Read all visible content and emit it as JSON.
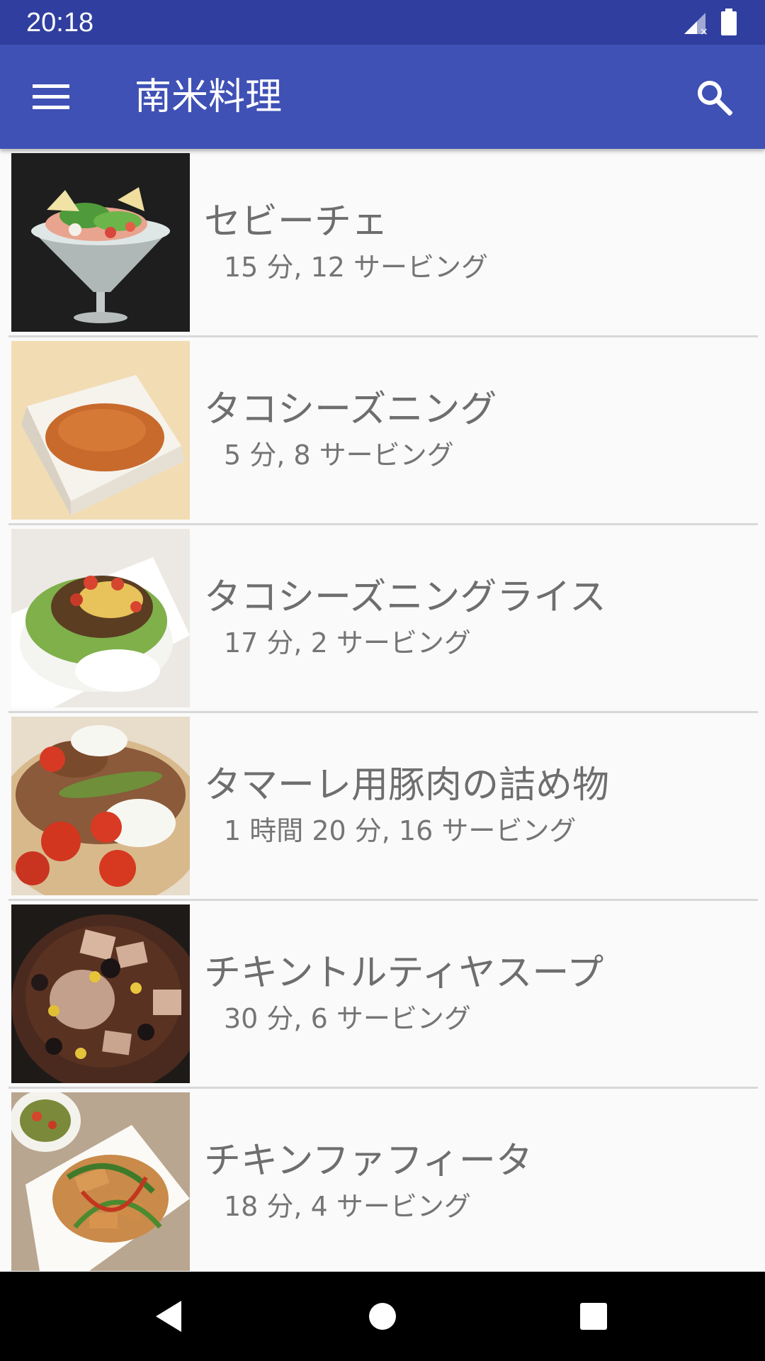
{
  "status_bar": {
    "time": "20:18",
    "icons": [
      "signal-icon",
      "battery-icon"
    ]
  },
  "app_bar": {
    "title": "南米料理",
    "menu_icon": "hamburger-menu-icon",
    "search_icon": "search-icon"
  },
  "recipes": [
    {
      "name": "セビーチェ",
      "meta": "15 分, 12 サービング",
      "thumbnail": "ceviche-photo"
    },
    {
      "name": "タコシーズニング",
      "meta": "5 分, 8 サービング",
      "thumbnail": "taco-seasoning-photo"
    },
    {
      "name": "タコシーズニングライス",
      "meta": "17 分, 2 サービング",
      "thumbnail": "taco-rice-photo"
    },
    {
      "name": "タマーレ用豚肉の詰め物",
      "meta": "1 時間 20 分, 16 サービング",
      "thumbnail": "pork-filling-photo"
    },
    {
      "name": "チキントルティヤスープ",
      "meta": "30 分, 6 サービング",
      "thumbnail": "tortilla-soup-photo"
    },
    {
      "name": "チキンファフィータ",
      "meta": "18 分, 4 サービング",
      "thumbnail": "chicken-fajita-photo"
    }
  ],
  "nav_bar": {
    "back_icon": "back-triangle-icon",
    "home_icon": "home-circle-icon",
    "recents_icon": "recents-square-icon"
  },
  "colors": {
    "status_bar": "#303f9f",
    "app_bar": "#3f51b5",
    "list_background": "#fafafa",
    "title_text": "#6e6e6e",
    "meta_text": "#757575"
  }
}
